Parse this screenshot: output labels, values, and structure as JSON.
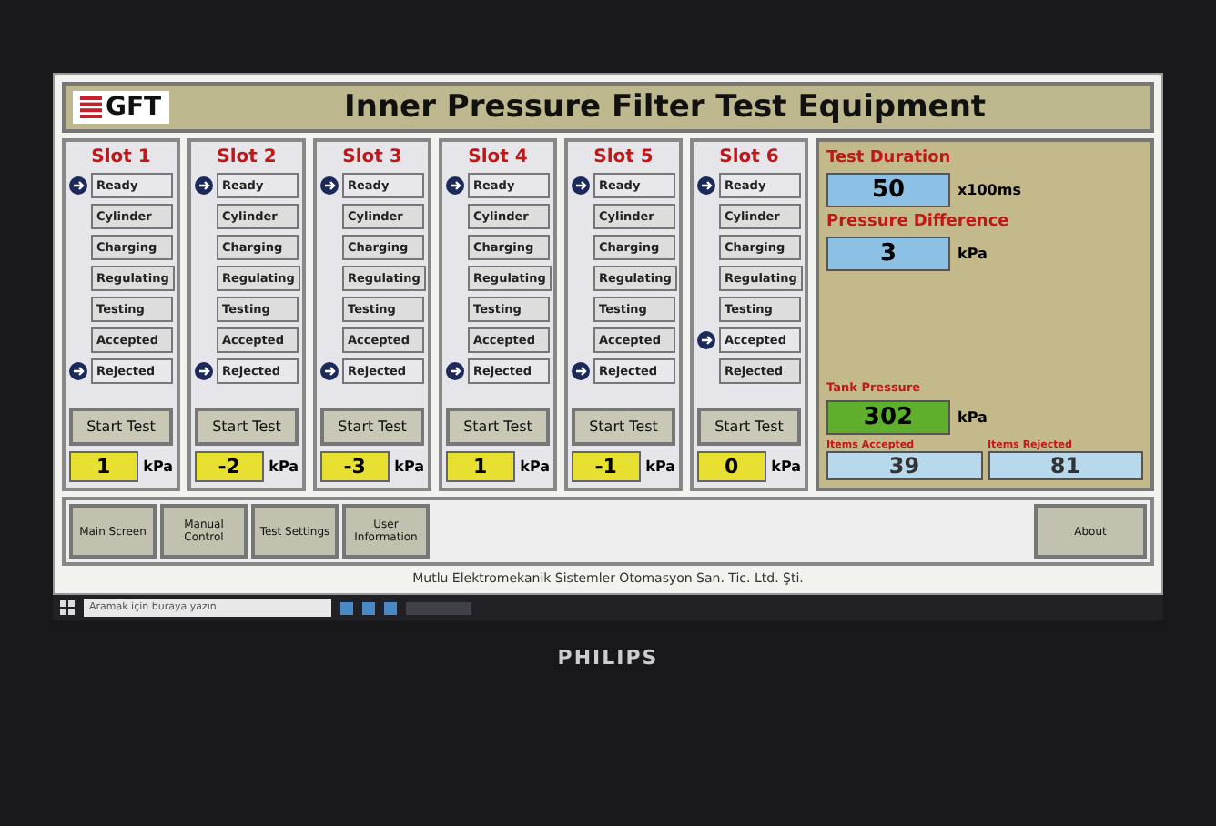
{
  "title": "Inner Pressure Filter Test Equipment",
  "logo": "GFT",
  "slots": [
    {
      "name": "Slot 1",
      "statuses": [
        {
          "label": "Ready",
          "active": true
        },
        {
          "label": "Cylinder",
          "active": false
        },
        {
          "label": "Charging",
          "active": false
        },
        {
          "label": "Regulating",
          "active": false
        },
        {
          "label": "Testing",
          "active": false
        },
        {
          "label": "Accepted",
          "active": false
        },
        {
          "label": "Rejected",
          "active": true
        }
      ],
      "button": "Start Test",
      "pressure": "1",
      "unit": "kPa"
    },
    {
      "name": "Slot 2",
      "statuses": [
        {
          "label": "Ready",
          "active": true
        },
        {
          "label": "Cylinder",
          "active": false
        },
        {
          "label": "Charging",
          "active": false
        },
        {
          "label": "Regulating",
          "active": false
        },
        {
          "label": "Testing",
          "active": false
        },
        {
          "label": "Accepted",
          "active": false
        },
        {
          "label": "Rejected",
          "active": true
        }
      ],
      "button": "Start Test",
      "pressure": "-2",
      "unit": "kPa"
    },
    {
      "name": "Slot 3",
      "statuses": [
        {
          "label": "Ready",
          "active": true
        },
        {
          "label": "Cylinder",
          "active": false
        },
        {
          "label": "Charging",
          "active": false
        },
        {
          "label": "Regulating",
          "active": false
        },
        {
          "label": "Testing",
          "active": false
        },
        {
          "label": "Accepted",
          "active": false
        },
        {
          "label": "Rejected",
          "active": true
        }
      ],
      "button": "Start Test",
      "pressure": "-3",
      "unit": "kPa"
    },
    {
      "name": "Slot 4",
      "statuses": [
        {
          "label": "Ready",
          "active": true
        },
        {
          "label": "Cylinder",
          "active": false
        },
        {
          "label": "Charging",
          "active": false
        },
        {
          "label": "Regulating",
          "active": false
        },
        {
          "label": "Testing",
          "active": false
        },
        {
          "label": "Accepted",
          "active": false
        },
        {
          "label": "Rejected",
          "active": true
        }
      ],
      "button": "Start Test",
      "pressure": "1",
      "unit": "kPa"
    },
    {
      "name": "Slot 5",
      "statuses": [
        {
          "label": "Ready",
          "active": true
        },
        {
          "label": "Cylinder",
          "active": false
        },
        {
          "label": "Charging",
          "active": false
        },
        {
          "label": "Regulating",
          "active": false
        },
        {
          "label": "Testing",
          "active": false
        },
        {
          "label": "Accepted",
          "active": false
        },
        {
          "label": "Rejected",
          "active": true
        }
      ],
      "button": "Start Test",
      "pressure": "-1",
      "unit": "kPa"
    },
    {
      "name": "Slot 6",
      "statuses": [
        {
          "label": "Ready",
          "active": true
        },
        {
          "label": "Cylinder",
          "active": false
        },
        {
          "label": "Charging",
          "active": false
        },
        {
          "label": "Regulating",
          "active": false
        },
        {
          "label": "Testing",
          "active": false
        },
        {
          "label": "Accepted",
          "active": true
        },
        {
          "label": "Rejected",
          "active": false
        }
      ],
      "button": "Start Test",
      "pressure": "0",
      "unit": "kPa"
    }
  ],
  "settings": {
    "test_duration": {
      "label": "Test Duration",
      "value": "50",
      "unit": "x100ms"
    },
    "pressure_difference": {
      "label": "Pressure Difference",
      "value": "3",
      "unit": "kPa"
    },
    "tank_pressure": {
      "label": "Tank Pressure",
      "value": "302",
      "unit": "kPa"
    },
    "items_accepted": {
      "label": "Items Accepted",
      "value": "39"
    },
    "items_rejected": {
      "label": "Items Rejected",
      "value": "81"
    }
  },
  "nav": [
    "Main Screen",
    "Manual Control",
    "Test Settings",
    "User Information"
  ],
  "about": "About",
  "footer": "Mutlu Elektromekanik Sistemler Otomasyon San. Tic. Ltd. Şti.",
  "taskbar": {
    "search_placeholder": "Aramak için buraya yazın"
  },
  "monitor_brand": "PHILIPS"
}
